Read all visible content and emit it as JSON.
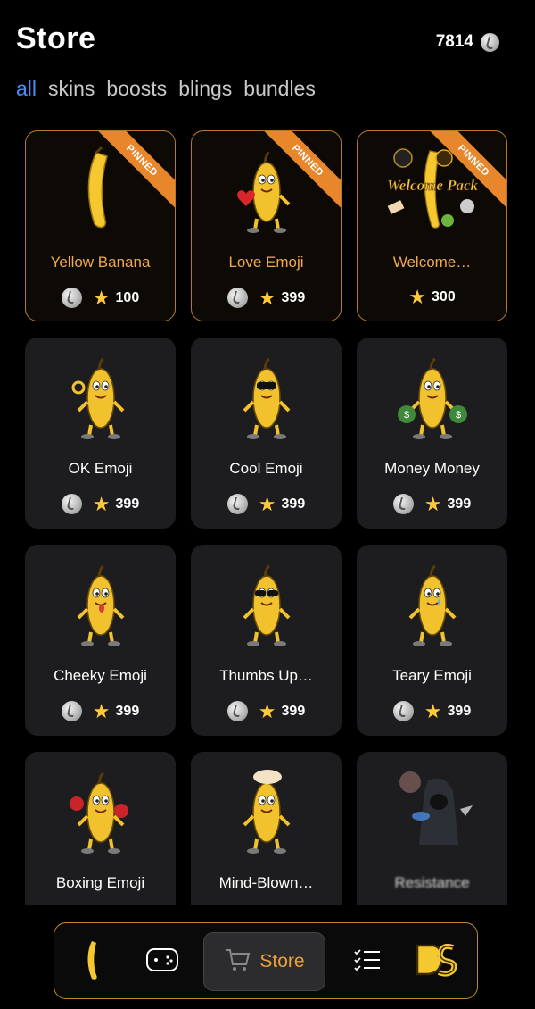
{
  "header": {
    "title": "Store",
    "balance": "7814",
    "balance_icon": "coin-icon"
  },
  "tabs": [
    {
      "label": "all",
      "active": true
    },
    {
      "label": "skins",
      "active": false
    },
    {
      "label": "boosts",
      "active": false
    },
    {
      "label": "blings",
      "active": false
    },
    {
      "label": "bundles",
      "active": false
    }
  ],
  "pinned_label": "PINNED",
  "items": [
    {
      "name": "Yellow Banana",
      "price": "100",
      "coin": true,
      "pinned": true,
      "art": "banana-icon"
    },
    {
      "name": "Love Emoji",
      "price": "399",
      "coin": true,
      "pinned": true,
      "art": "love-banana-icon"
    },
    {
      "name": "Welcome…",
      "price": "300",
      "coin": false,
      "pinned": true,
      "art": "welcome-pack-icon",
      "art_text": "Welcome Pack"
    },
    {
      "name": "OK Emoji",
      "price": "399",
      "coin": true,
      "pinned": false,
      "art": "ok-banana-icon"
    },
    {
      "name": "Cool Emoji",
      "price": "399",
      "coin": true,
      "pinned": false,
      "art": "cool-banana-icon"
    },
    {
      "name": "Money Money",
      "price": "399",
      "coin": true,
      "pinned": false,
      "art": "money-banana-icon"
    },
    {
      "name": "Cheeky Emoji",
      "price": "399",
      "coin": true,
      "pinned": false,
      "art": "cheeky-banana-icon"
    },
    {
      "name": "Thumbs Up…",
      "price": "399",
      "coin": true,
      "pinned": false,
      "art": "thumbs-up-banana-icon"
    },
    {
      "name": "Teary Emoji",
      "price": "399",
      "coin": true,
      "pinned": false,
      "art": "teary-banana-icon"
    },
    {
      "name": "Boxing Emoji",
      "price": "",
      "coin": false,
      "pinned": false,
      "art": "boxing-banana-icon"
    },
    {
      "name": "Mind-Blown…",
      "price": "",
      "coin": false,
      "pinned": false,
      "art": "mind-blown-banana-icon"
    },
    {
      "name": "Resistance",
      "price": "",
      "coin": false,
      "pinned": false,
      "art": "hooded-figure-icon"
    }
  ],
  "nav": {
    "items": [
      {
        "icon": "banana-icon"
      },
      {
        "icon": "gamepad-icon"
      },
      {
        "icon": "cart-icon",
        "label": "Store",
        "active": true
      },
      {
        "icon": "checklist-icon"
      },
      {
        "icon": "bs-logo-icon"
      }
    ]
  },
  "colors": {
    "accent": "#e9a13a",
    "tab_active": "#4a8cf4",
    "card_bg": "#1d1d1f",
    "pinned_border": "#b77a2c",
    "ribbon": "#e7862b"
  }
}
